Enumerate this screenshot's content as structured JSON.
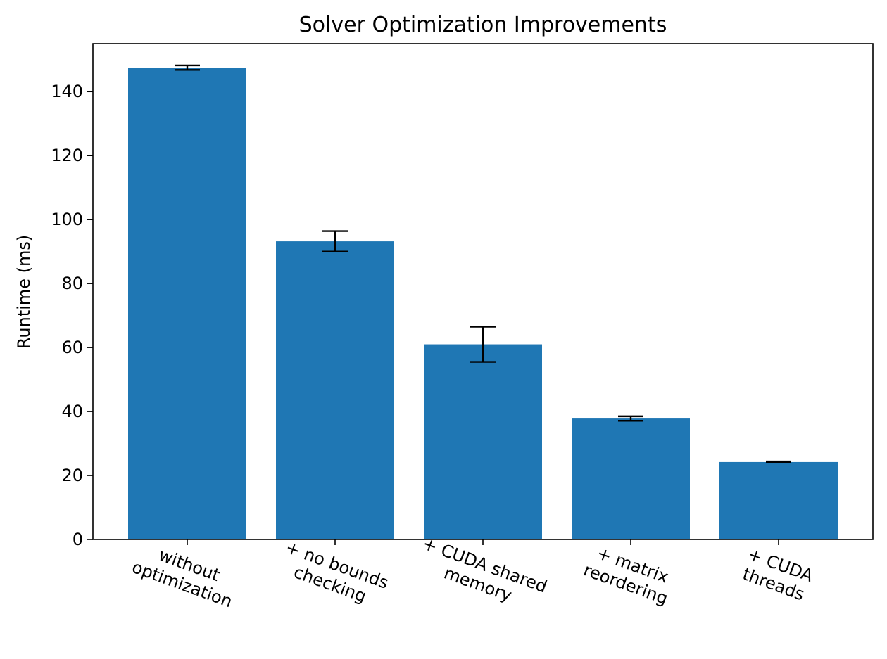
{
  "chart_data": {
    "type": "bar",
    "title": "Solver Optimization Improvements",
    "xlabel": "",
    "ylabel": "Runtime (ms)",
    "ylim": [
      0,
      155
    ],
    "yticks": [
      0,
      20,
      40,
      60,
      80,
      100,
      120,
      140
    ],
    "ytick_labels": [
      "0",
      "20",
      "40",
      "60",
      "80",
      "100",
      "120",
      "140"
    ],
    "categories": [
      [
        "without",
        "optimization"
      ],
      [
        "+ no bounds",
        "checking"
      ],
      [
        "+ CUDA shared",
        "memory"
      ],
      [
        "+ matrix",
        "reordering"
      ],
      [
        "+ CUDA",
        "threads"
      ]
    ],
    "values": [
      147.5,
      93.2,
      61.0,
      37.8,
      24.2
    ],
    "errors": [
      0.7,
      3.2,
      5.5,
      0.7,
      0.2
    ],
    "bar_color": "#1f77b4",
    "error_color": "#000000",
    "grid": false,
    "legend": "none"
  }
}
